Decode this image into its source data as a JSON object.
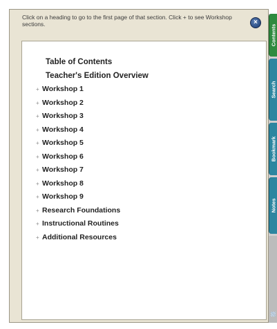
{
  "panel": {
    "hint": "Click on a heading to go to the first page of that section.  Click + to see Workshop sections."
  },
  "toc": {
    "headings": [
      "Table of Contents",
      "Teacher's Edition Overview"
    ],
    "items": [
      {
        "label": "Workshop 1"
      },
      {
        "label": "Workshop 2"
      },
      {
        "label": "Workshop 3"
      },
      {
        "label": "Workshop 4"
      },
      {
        "label": "Workshop 5"
      },
      {
        "label": "Workshop 6"
      },
      {
        "label": "Workshop 7"
      },
      {
        "label": "Workshop 8"
      },
      {
        "label": "Workshop 9"
      },
      {
        "label": "Research Foundations"
      },
      {
        "label": "Instructional Routines"
      },
      {
        "label": "Additional Resources"
      }
    ],
    "expand_glyph": "+"
  },
  "tabs": [
    {
      "label": "Contents"
    },
    {
      "label": "Search"
    },
    {
      "label": "Bookmark"
    },
    {
      "label": "Notes"
    }
  ],
  "colors": {
    "panel_background": "#e9e4d4",
    "active_tab": "#2f8a3f",
    "inactive_tab": "#2d86a0",
    "close_button": "#2d4f85"
  },
  "icons": {
    "close": "close-icon"
  }
}
